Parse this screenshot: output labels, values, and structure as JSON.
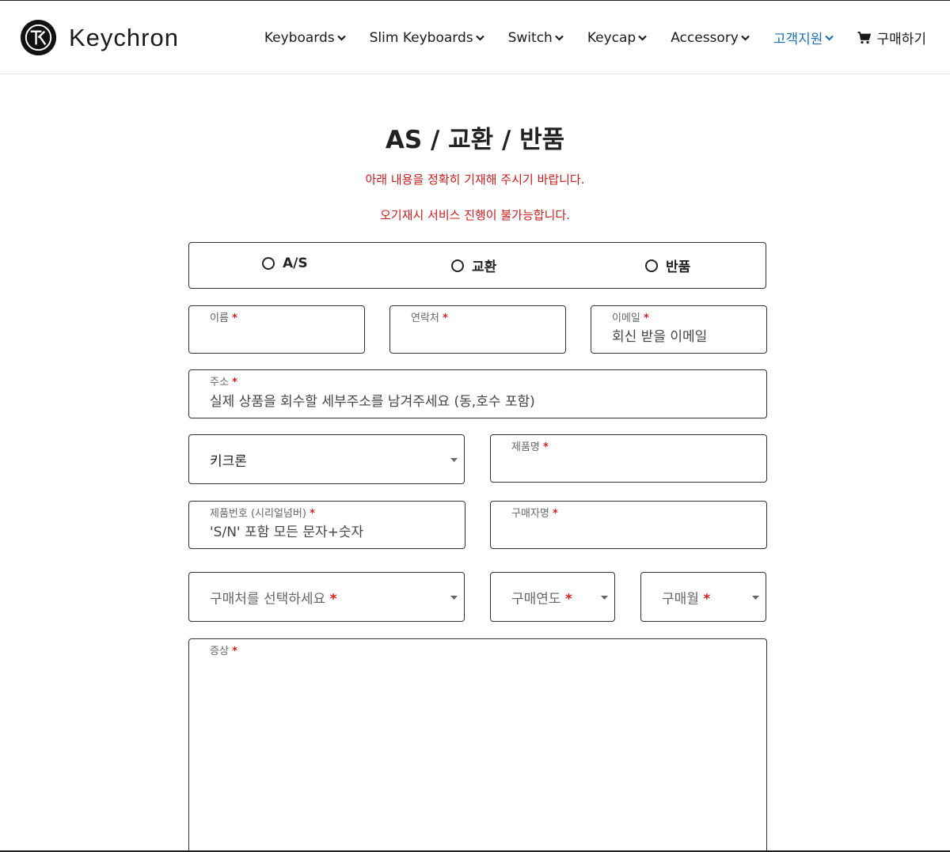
{
  "brand": {
    "name": "Keychron"
  },
  "nav": {
    "items": [
      {
        "label": "Keyboards"
      },
      {
        "label": "Slim Keyboards"
      },
      {
        "label": "Switch"
      },
      {
        "label": "Keycap"
      },
      {
        "label": "Accessory"
      },
      {
        "label": "고객지원"
      }
    ],
    "cart_label": "구매하기",
    "active_color": "#1f6fb2"
  },
  "page": {
    "title": "AS / 교환 / 반품",
    "notice_1": "아래 내용을 정확히 기재해 주시기 바랍니다.",
    "notice_2": "오기재시 서비스 진행이 불가능합니다."
  },
  "form": {
    "request_types": [
      {
        "label": "A/S",
        "selected": false
      },
      {
        "label": "교환",
        "selected": false
      },
      {
        "label": "반품",
        "selected": false
      }
    ],
    "required_mark": "*",
    "name": {
      "label": "이름",
      "value": ""
    },
    "phone": {
      "label": "연락처",
      "value": ""
    },
    "email": {
      "label": "이메일",
      "placeholder": "회신 받을 이메일"
    },
    "address": {
      "label": "주소",
      "placeholder": "실제 상품을 회수할 세부주소를 남겨주세요 (동,호수 포함)"
    },
    "brand_select": {
      "value": "키크론"
    },
    "product_name": {
      "label": "제품명",
      "value": ""
    },
    "serial": {
      "label": "제품번호 (시리얼넘버)",
      "placeholder": "'S/N' 포함 모든 문자+숫자"
    },
    "buyer_name": {
      "label": "구매자명",
      "value": ""
    },
    "purchase_place": {
      "placeholder": "구매처를 선택하세요"
    },
    "purchase_year": {
      "placeholder": "구매연도"
    },
    "purchase_month": {
      "placeholder": "구매월"
    },
    "symptom": {
      "label": "증상",
      "value": ""
    }
  },
  "colors": {
    "required": "#d61f1f",
    "notice": "#c91d1d"
  },
  "icons": {
    "logo": "keychron-logo-icon",
    "chevron": "chevron-down-icon",
    "cart": "cart-icon",
    "caret": "caret-down-icon"
  }
}
